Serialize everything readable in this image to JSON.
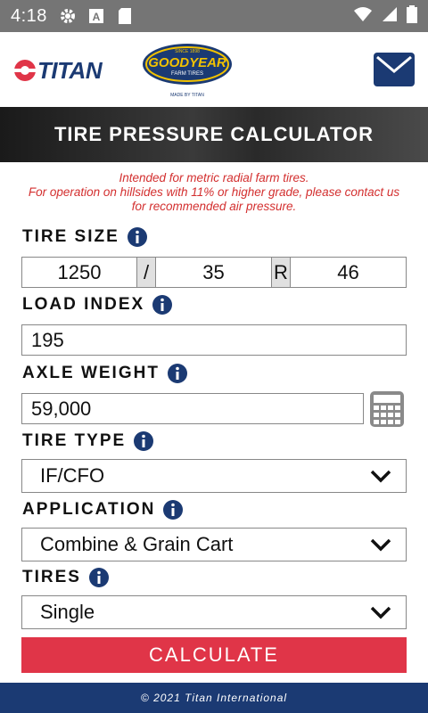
{
  "status_bar": {
    "time": "4:18",
    "icons": [
      "gear-icon",
      "a-badge-icon",
      "sd-card-icon",
      "wifi-icon",
      "signal-icon",
      "battery-icon"
    ]
  },
  "header": {
    "titan_logo_text": "TITAN",
    "goodyear_logo": {
      "top": "SINCE 1898",
      "name": "GOODYEAR",
      "sub": "FARM TIRES",
      "made_by": "MADE BY TITAN"
    },
    "mail_icon": "mail-icon"
  },
  "banner": {
    "title": "TIRE PRESSURE CALCULATOR"
  },
  "notice": {
    "line1": "Intended for metric radial farm tires.",
    "line2": "For operation on hillsides with 11% or higher grade, please contact us",
    "line3": "for recommended air pressure."
  },
  "tire_size": {
    "label": "TIRE SIZE",
    "width": "1250",
    "sep1": "/",
    "aspect": "35",
    "sep2": "R",
    "rim": "46"
  },
  "load_index": {
    "label": "LOAD INDEX",
    "value": "195"
  },
  "axle_weight": {
    "label": "AXLE WEIGHT",
    "value": "59,000"
  },
  "tire_type": {
    "label": "TIRE TYPE",
    "value": "IF/CFO"
  },
  "application": {
    "label": "APPLICATION",
    "value": "Combine & Grain Cart"
  },
  "tires": {
    "label": "TIRES",
    "value": "Single"
  },
  "calculate_label": "CALCULATE",
  "footer": {
    "text": "© 2021 Titan International"
  },
  "colors": {
    "status_bar": "#757575",
    "navy": "#1b3a73",
    "notice_red": "#d32f2f",
    "button_red": "#e03548",
    "info_blue": "#1b3a73"
  }
}
